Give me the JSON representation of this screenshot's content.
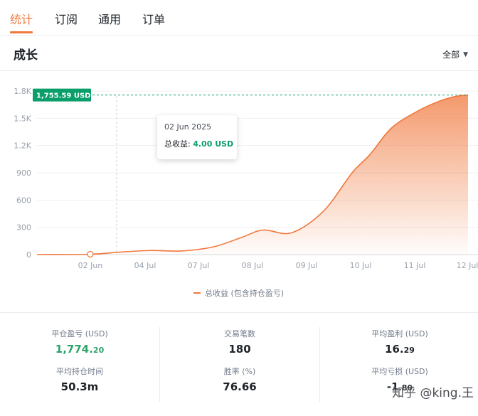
{
  "tabs": [
    {
      "label": "统计"
    },
    {
      "label": "订阅"
    },
    {
      "label": "通用"
    },
    {
      "label": "订单"
    }
  ],
  "section": {
    "title": "成长",
    "filter": "全部"
  },
  "colors": {
    "accent": "#f0783c",
    "positive": "#2ea36a",
    "reference": "#0a9e6a"
  },
  "tooltip": {
    "date": "02 Jun 2025",
    "label": "总收益:",
    "value": "4.00 USD"
  },
  "reference_label": "1,755.59 USD",
  "chart_data": {
    "type": "area",
    "series": [
      {
        "name": "总收益 (包含持仓盈亏)",
        "x": [
          "01 Jun",
          "02 Jun",
          "03 Jun",
          "04 Jul",
          "05 Jul",
          "06 Jul",
          "07 Jul",
          "07.5 Jul",
          "08 Jul",
          "08.5 Jul",
          "09 Jul",
          "09.5 Jul",
          "10 Jul",
          "10.5 Jul",
          "11 Jul",
          "11.5 Jul",
          "12 Jul"
        ],
        "values": [
          0,
          4,
          25,
          45,
          40,
          85,
          190,
          270,
          240,
          480,
          900,
          1100,
          1390,
          1570,
          1680,
          1740,
          1755.59
        ]
      }
    ],
    "x_ticks": [
      "02 Jun",
      "04 Jul",
      "07 Jul",
      "08 Jul",
      "09 Jul",
      "10 Jul",
      "11 Jul",
      "12 Jul"
    ],
    "y_ticks": [
      "0",
      "300",
      "600",
      "900",
      "1.2K",
      "1.5K",
      "1.8K"
    ],
    "ylim": [
      0,
      1800
    ],
    "grid": true,
    "legend": "bottom-center",
    "max_value_label": "1,755.59 USD"
  },
  "stats": {
    "realized_pnl": {
      "label": "平仓盈亏 (USD)",
      "int": "1,774.",
      "dec": "20"
    },
    "trade_count": {
      "label": "交易笔数",
      "value": "180"
    },
    "avg_profit": {
      "label": "平均盈利 (USD)",
      "int": "16.",
      "dec": "29"
    },
    "avg_hold_time": {
      "label": "平均持仓时间",
      "value": "50.3m"
    },
    "win_rate": {
      "label": "胜率 (%)",
      "value": "76.66"
    },
    "avg_loss": {
      "label": "平均亏损 (USD)",
      "int": "-1",
      "dec": ".80"
    }
  },
  "watermark": "知乎 @king.王"
}
